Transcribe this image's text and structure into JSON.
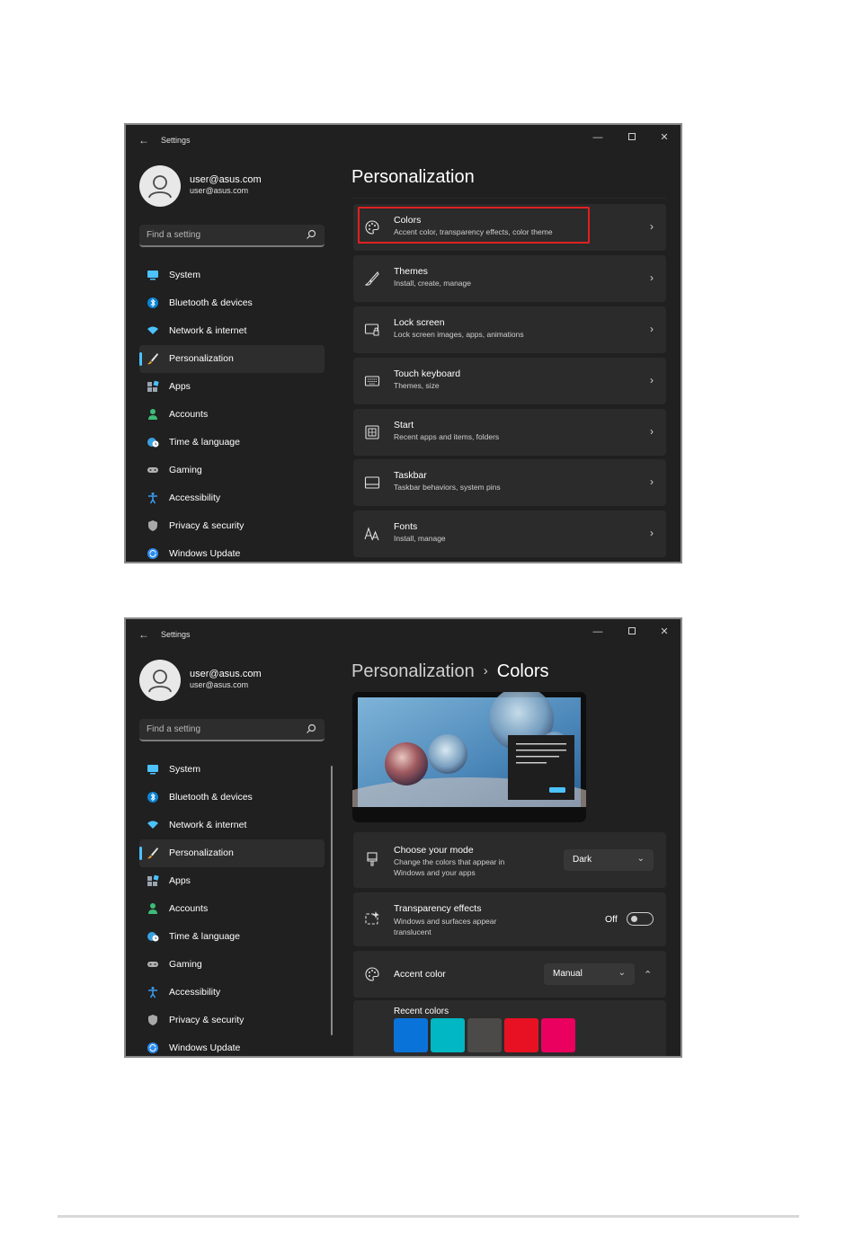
{
  "window": {
    "app_title": "Settings",
    "back_glyph": "←",
    "minimize_glyph": "—",
    "close_glyph": "✕"
  },
  "user": {
    "name": "user@asus.com",
    "email": "user@asus.com"
  },
  "search": {
    "placeholder": "Find a setting",
    "icon": "search-icon"
  },
  "nav": [
    {
      "label": "System",
      "icon": "system-icon",
      "color": "#4cc2ff"
    },
    {
      "label": "Bluetooth & devices",
      "icon": "bluetooth-icon",
      "color": "#0a84d6"
    },
    {
      "label": "Network & internet",
      "icon": "wifi-icon",
      "color": "#4cc2ff"
    },
    {
      "label": "Personalization",
      "icon": "brush-icon",
      "color": "#f0a030",
      "active": true
    },
    {
      "label": "Apps",
      "icon": "apps-icon",
      "color": "#9aa4b0"
    },
    {
      "label": "Accounts",
      "icon": "person-icon",
      "color": "#3dbb78"
    },
    {
      "label": "Time & language",
      "icon": "globe-clock-icon",
      "color": "#3aa0e0"
    },
    {
      "label": "Gaming",
      "icon": "gamepad-icon",
      "color": "#b0b0b0"
    },
    {
      "label": "Accessibility",
      "icon": "accessibility-icon",
      "color": "#3a9ef0"
    },
    {
      "label": "Privacy & security",
      "icon": "shield-icon",
      "color": "#a8a8a8"
    },
    {
      "label": "Windows Update",
      "icon": "update-icon",
      "color": "#2d8cf0"
    }
  ],
  "screen1": {
    "title": "Personalization",
    "cards": [
      {
        "title": "Colors",
        "subtitle": "Accent color, transparency effects, color theme",
        "icon": "palette-icon",
        "highlighted": true
      },
      {
        "title": "Themes",
        "subtitle": "Install, create, manage",
        "icon": "brush-icon"
      },
      {
        "title": "Lock screen",
        "subtitle": "Lock screen images, apps, animations",
        "icon": "lock-screen-icon"
      },
      {
        "title": "Touch keyboard",
        "subtitle": "Themes, size",
        "icon": "keyboard-icon"
      },
      {
        "title": "Start",
        "subtitle": "Recent apps and items, folders",
        "icon": "start-icon"
      },
      {
        "title": "Taskbar",
        "subtitle": "Taskbar behaviors, system pins",
        "icon": "taskbar-icon"
      },
      {
        "title": "Fonts",
        "subtitle": "Install, manage",
        "icon": "fonts-icon"
      }
    ],
    "highlight_color": "#e02020"
  },
  "screen2": {
    "breadcrumb_parent": "Personalization",
    "breadcrumb_separator": "›",
    "breadcrumb_current": "Colors",
    "mode": {
      "title": "Choose your mode",
      "subtitle": "Change the colors that appear in Windows and your apps",
      "value": "Dark",
      "icon": "brush-mode-icon"
    },
    "transparency": {
      "title": "Transparency effects",
      "subtitle": "Windows and surfaces appear translucent",
      "state_label": "Off",
      "on": false,
      "icon": "sparkle-icon"
    },
    "accent": {
      "title": "Accent color",
      "value": "Manual",
      "icon": "palette-icon",
      "expanded": true
    },
    "recent_colors_label": "Recent colors",
    "recent_colors": [
      "#0a73d9",
      "#00b7c3",
      "#4c4a48",
      "#e81123",
      "#ea005e"
    ]
  },
  "glyphs": {
    "chevron_right": "›",
    "chevron_down": "⌄",
    "chevron_up": "⌃"
  },
  "accent_color": "#4cc2ff"
}
